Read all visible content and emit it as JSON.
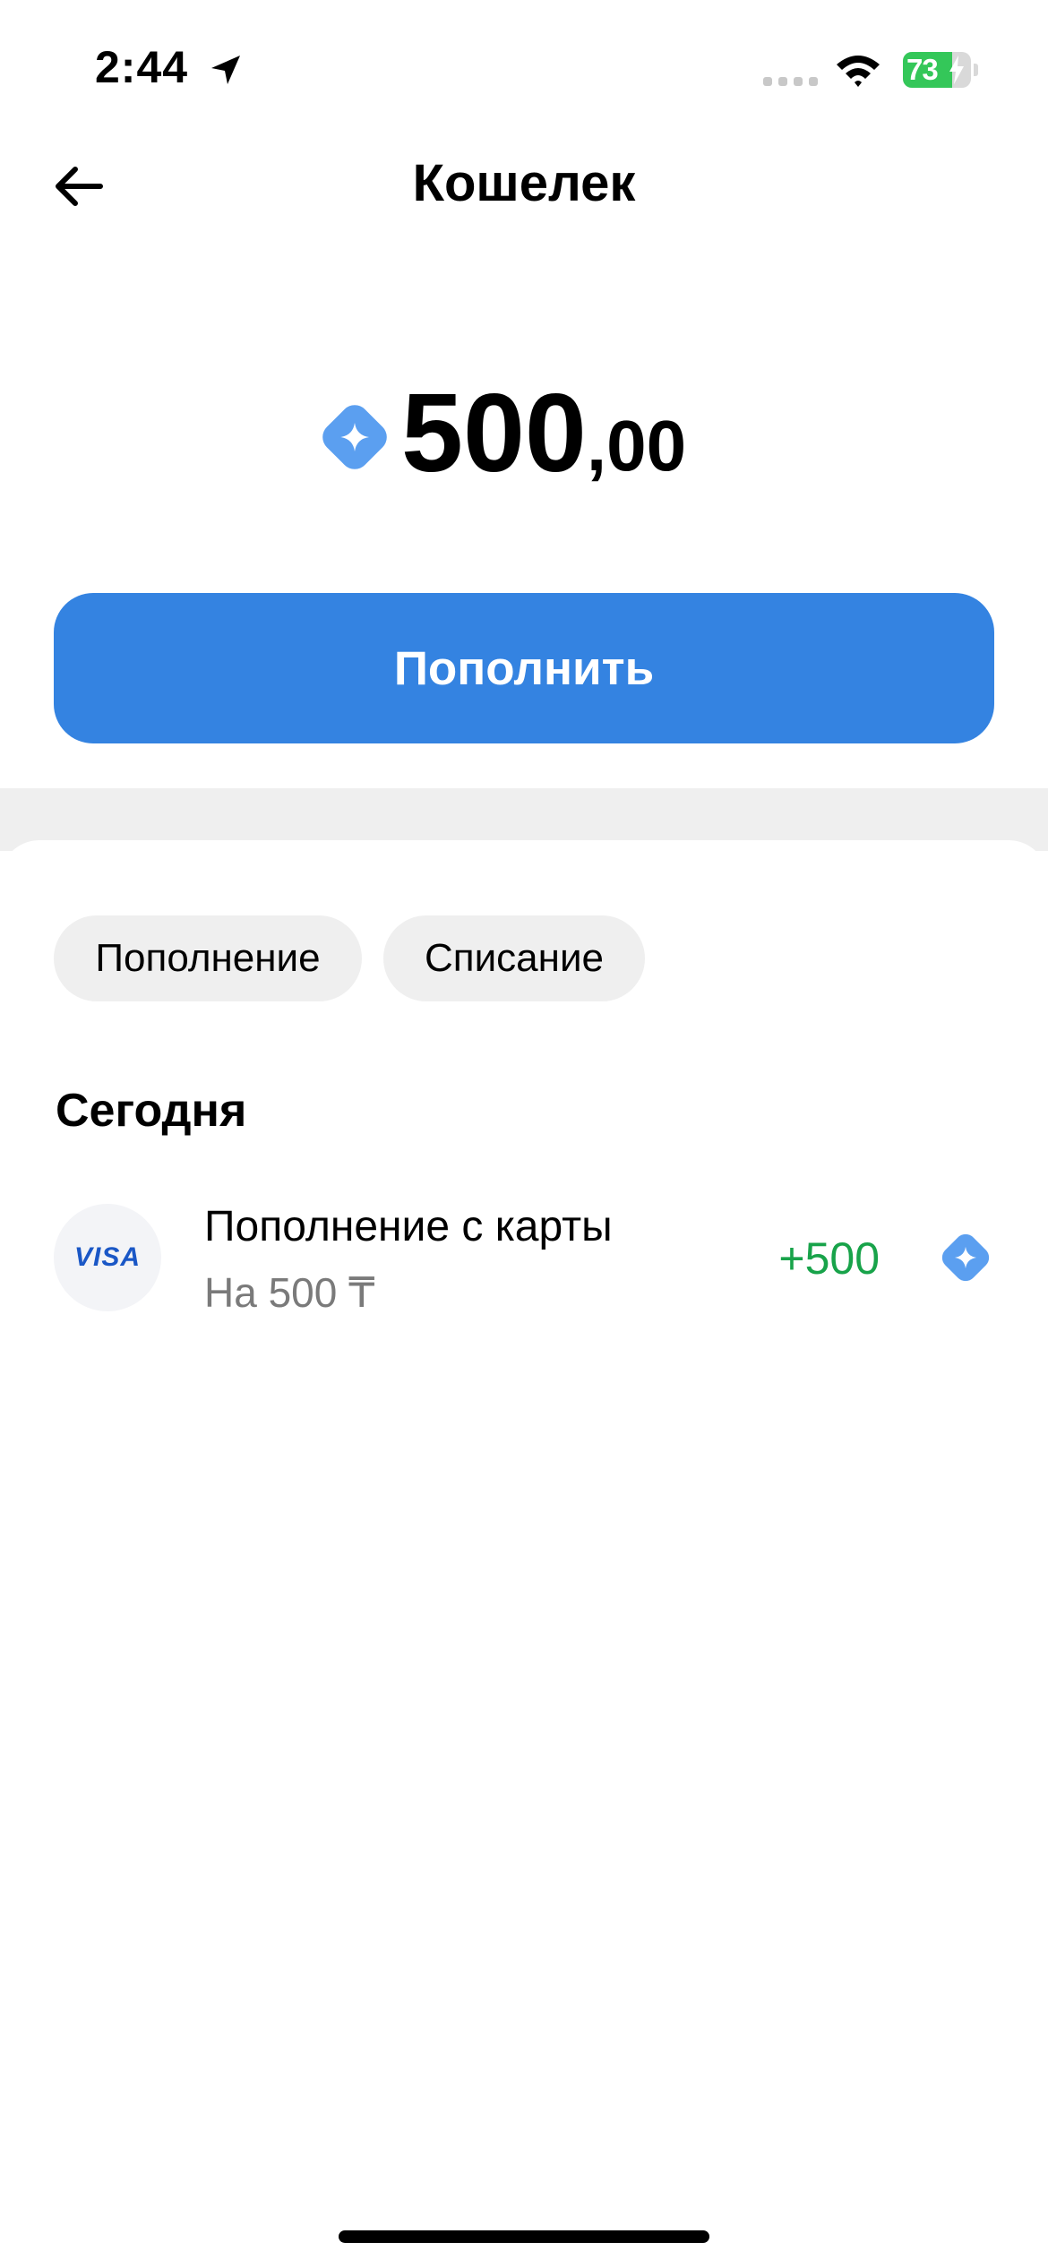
{
  "status_bar": {
    "time": "2:44",
    "battery_level": "73",
    "battery_fraction": 0.73,
    "battery_color": "#34c759"
  },
  "header": {
    "back_icon": "arrow-left-icon",
    "title": "Кошелек"
  },
  "balance": {
    "currency_icon": "sparkle-coin-icon",
    "integer": "500",
    "fraction": ",00"
  },
  "topup_button": {
    "label": "Пополнить",
    "color": "#3483e1"
  },
  "filters": [
    {
      "label": "Пополнение"
    },
    {
      "label": "Списание"
    }
  ],
  "history": {
    "section_title": "Сегодня",
    "transactions": [
      {
        "icon_text": "VISA",
        "title": "Пополнение с карты",
        "subtitle": "На 500 ₸",
        "amount": "+500",
        "amount_color": "#18a34a",
        "currency_icon": "sparkle-coin-icon"
      }
    ]
  }
}
